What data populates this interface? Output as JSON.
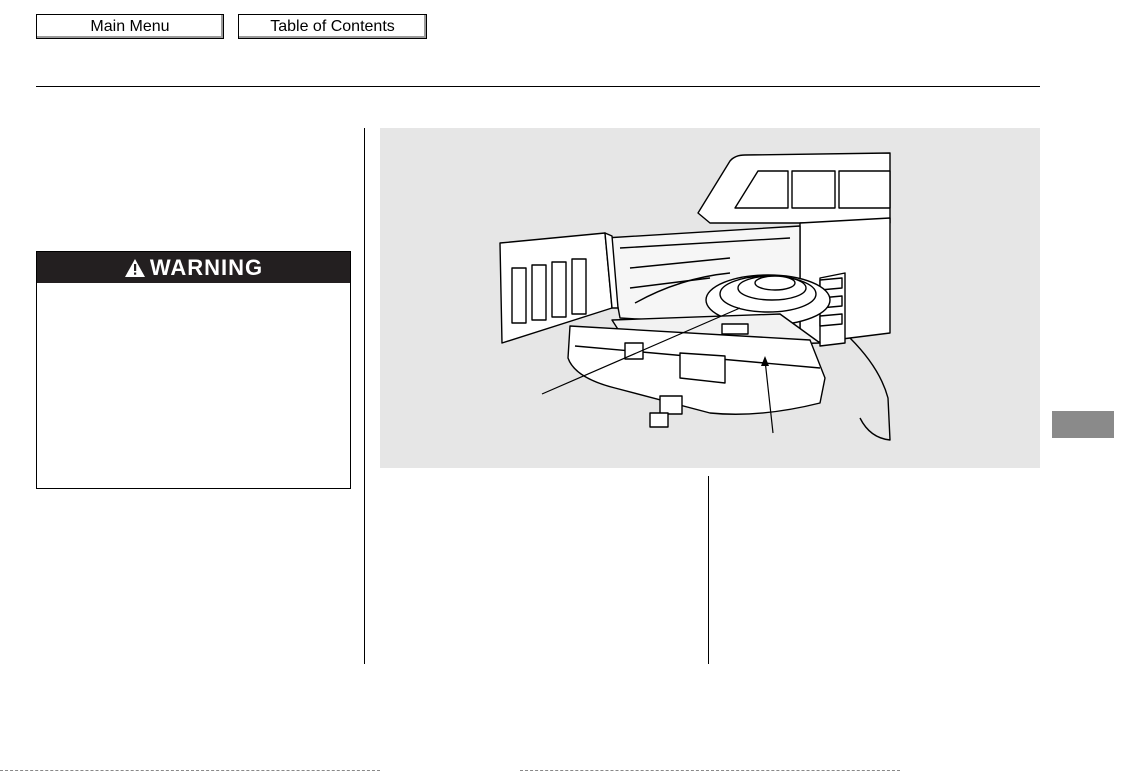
{
  "nav": {
    "main_menu_label": "Main Menu",
    "toc_label": "Table of Contents"
  },
  "warning": {
    "title": "WARNING",
    "icon": "warning-triangle-icon"
  },
  "figure": {
    "subject": "pickup-truck-bed-spare-tire-illustration"
  },
  "colors": {
    "figure_background": "#e6e6e6",
    "warning_header": "#231f20",
    "side_tab": "#8a8a8a"
  }
}
